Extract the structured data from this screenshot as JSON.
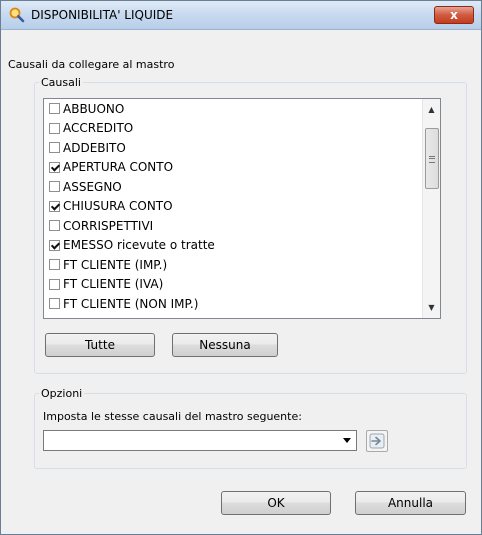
{
  "window": {
    "title": "DISPONIBILITA' LIQUIDE",
    "close_glyph": "x"
  },
  "header_label": "Causali da collegare al mastro",
  "causali": {
    "legend": "Causali",
    "items": [
      {
        "label": "ABBUONO",
        "checked": false
      },
      {
        "label": "ACCREDITO",
        "checked": false
      },
      {
        "label": "ADDEBITO",
        "checked": false
      },
      {
        "label": "APERTURA CONTO",
        "checked": true
      },
      {
        "label": "ASSEGNO",
        "checked": false
      },
      {
        "label": "CHIUSURA CONTO",
        "checked": true
      },
      {
        "label": "CORRISPETTIVI",
        "checked": false
      },
      {
        "label": "EMESSO ricevute o tratte",
        "checked": true
      },
      {
        "label": "FT CLIENTE (IMP.)",
        "checked": false
      },
      {
        "label": "FT CLIENTE (IVA)",
        "checked": false
      },
      {
        "label": "FT CLIENTE (NON IMP.)",
        "checked": false
      }
    ],
    "buttons": {
      "all": "Tutte",
      "none": "Nessuna"
    }
  },
  "opzioni": {
    "legend": "Opzioni",
    "label": "Imposta le stesse causali del mastro seguente:",
    "selected_value": ""
  },
  "footer": {
    "ok": "OK",
    "cancel": "Annulla"
  },
  "icons": {
    "title": "magnifier-icon",
    "apply": "arrow-right-icon"
  },
  "colors": {
    "title_bar": "#c5d8ee",
    "close_button": "#c43c1f",
    "group_border": "#d5dfe5"
  }
}
